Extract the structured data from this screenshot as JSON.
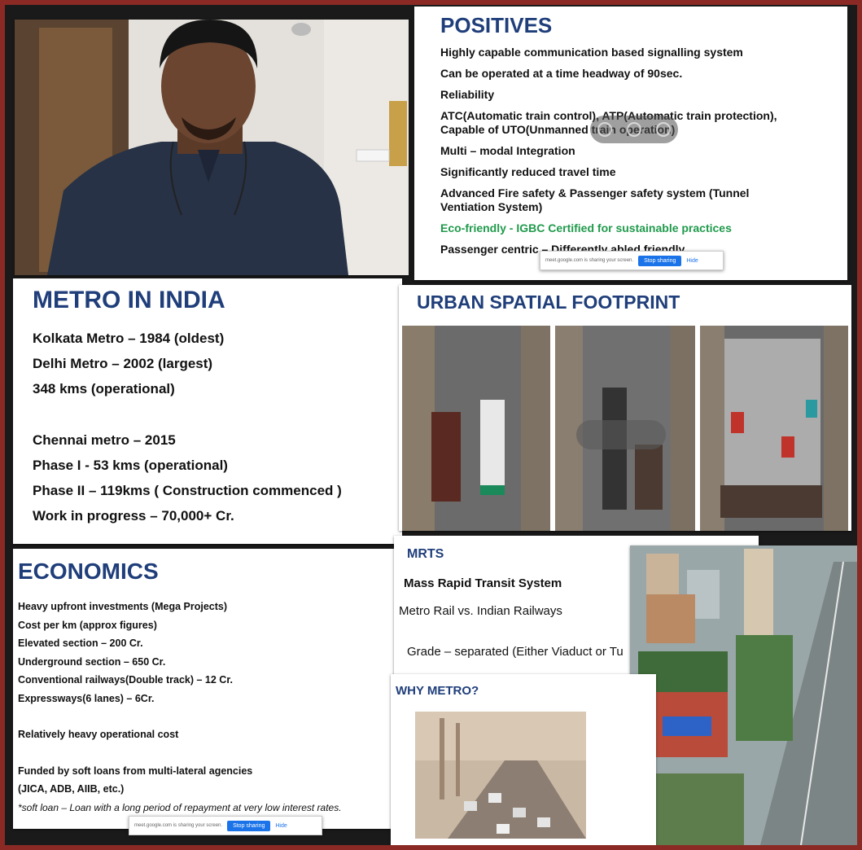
{
  "positives": {
    "title": "POSITIVES",
    "items": [
      "Highly capable communication based signalling system",
      "Can be operated at a time headway of 90sec.",
      "Reliability",
      "ATC(Automatic train control), ATP(Automatic train protection), Capable of UTO(Unmanned train operation)",
      "Multi – modal Integration",
      "Significantly reduced travel time",
      "Advanced Fire safety & Passenger safety system (Tunnel Ventiation System)",
      "Eco-friendly - IGBC Certified for sustainable practices",
      "Passenger centric – Differently abled friendly"
    ]
  },
  "metro_india": {
    "title": "METRO IN INDIA",
    "items": [
      "Kolkata Metro – 1984 (oldest)",
      "Delhi Metro – 2002 (largest)",
      "348 kms (operational)",
      "Chennai metro – 2015",
      "Phase I - 53 kms (operational)",
      "Phase II – 119kms ( Construction commenced )",
      "Work in progress – 70,000+ Cr."
    ]
  },
  "urban": {
    "title": "URBAN SPATIAL FOOTPRINT"
  },
  "economics": {
    "title": "ECONOMICS",
    "items": [
      "Heavy upfront investments (Mega Projects)",
      "Cost per km (approx figures)",
      " Elevated section – 200 Cr.",
      " Underground section – 650 Cr.",
      " Conventional railways(Double track) – 12 Cr.",
      " Expressways(6 lanes) – 6Cr.",
      "",
      "Relatively heavy operational cost",
      "",
      "Funded by soft loans from multi-lateral agencies",
      "(JICA, ADB, AIIB, etc.)",
      "*soft loan – Loan with a long period of repayment  at very low interest rates."
    ]
  },
  "mrts": {
    "title": "MRTS",
    "line1": "Mass Rapid Transit System",
    "line2": "Metro Rail vs. Indian Railways",
    "line3": "Grade – separated (Either Viaduct or Tu"
  },
  "why_metro": {
    "title": "WHY METRO?"
  },
  "share_bar": {
    "message": "meet.google.com is sharing your screen.",
    "stop": "Stop sharing",
    "hide": "Hide"
  }
}
